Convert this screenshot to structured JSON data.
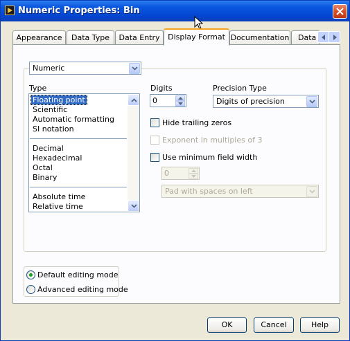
{
  "window": {
    "title": "Numeric Properties: Bin"
  },
  "tabs": [
    {
      "label": "Appearance"
    },
    {
      "label": "Data Type"
    },
    {
      "label": "Data Entry"
    },
    {
      "label": "Display Format"
    },
    {
      "label": "Documentation"
    },
    {
      "label": "Data B"
    }
  ],
  "active_tab": "Display Format",
  "format_target": {
    "selected": "Numeric"
  },
  "type": {
    "label": "Type",
    "groups": [
      [
        "Floating point",
        "Scientific",
        "Automatic formatting",
        "SI notation"
      ],
      [
        "Decimal",
        "Hexadecimal",
        "Octal",
        "Binary"
      ],
      [
        "Absolute time",
        "Relative time"
      ]
    ],
    "selected": "Floating point"
  },
  "digits": {
    "label": "Digits",
    "value": "0"
  },
  "precision_type": {
    "label": "Precision Type",
    "selected": "Digits of precision"
  },
  "hide_trailing_zeros": {
    "label": "Hide trailing zeros",
    "checked": false
  },
  "exponent_multiples": {
    "label": "Exponent in multiples of 3",
    "checked": false,
    "enabled": false
  },
  "min_field_width": {
    "label": "Use minimum field width",
    "checked": false
  },
  "field_width": {
    "value": "0",
    "enabled": false
  },
  "padding": {
    "selected": "Pad with spaces on left",
    "enabled": false
  },
  "editing_mode": {
    "options": [
      "Default editing mode",
      "Advanced editing mode"
    ],
    "selected": "Default editing mode"
  },
  "buttons": {
    "ok": "OK",
    "cancel": "Cancel",
    "help": "Help"
  },
  "colors": {
    "titlebar": "#0a57e0",
    "selection": "#316ac5",
    "active_tab_accent": "#f7a21f",
    "dialog_bg": "#ece9d8"
  }
}
